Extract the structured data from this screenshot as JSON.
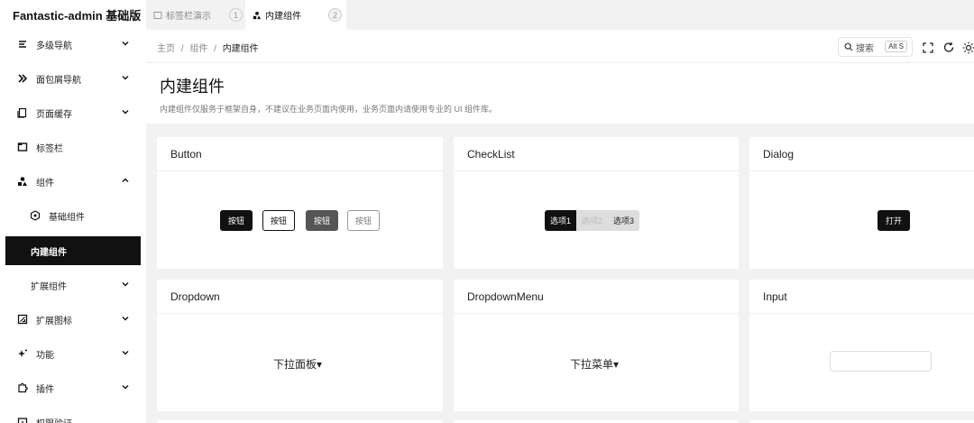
{
  "app": {
    "title": "Fantastic-admin 基础版"
  },
  "sidebar": {
    "items": [
      {
        "label": "多级导航",
        "icon": "menu-lines-icon",
        "chevron": "down"
      },
      {
        "label": "面包屑导航",
        "icon": "double-chevron-icon",
        "chevron": "down"
      },
      {
        "label": "页面缓存",
        "icon": "pages-icon",
        "chevron": "down"
      },
      {
        "label": "标签栏",
        "icon": "tab-window-icon"
      },
      {
        "label": "组件",
        "icon": "shapes-icon",
        "chevron": "up"
      },
      {
        "label": "基础组件",
        "icon": "component-icon"
      },
      {
        "label": "内建组件",
        "active": true
      },
      {
        "label": "扩展组件",
        "chevron": "down"
      },
      {
        "label": "扩展图标",
        "icon": "icon-box-icon",
        "chevron": "down"
      },
      {
        "label": "功能",
        "icon": "sparkle-icon",
        "chevron": "down"
      },
      {
        "label": "插件",
        "icon": "puzzle-icon",
        "chevron": "down"
      },
      {
        "label": "权限验证",
        "icon": "shield-icon"
      }
    ]
  },
  "tabs": [
    {
      "label": "标签栏演示",
      "num": "1"
    },
    {
      "label": "内建组件",
      "num": "2",
      "active": true
    }
  ],
  "breadcrumb": {
    "home": "主页",
    "sep": "/",
    "parent": "组件",
    "current": "内建组件"
  },
  "search": {
    "label": "搜索",
    "shortcut": "Alt S"
  },
  "page": {
    "title": "内建组件",
    "description": "内建组件仅服务于框架自身，不建议在业务页面内使用，业务页面内请使用专业的 UI 组件库。"
  },
  "cards": {
    "button": {
      "title": "Button",
      "buttons": [
        "按钮",
        "按钮",
        "按钮",
        "按钮"
      ]
    },
    "checklist": {
      "title": "CheckList",
      "options": [
        "选项1",
        "选项2",
        "选项3"
      ]
    },
    "dialog": {
      "title": "Dialog",
      "open_label": "打开"
    },
    "dropdown": {
      "title": "Dropdown",
      "trigger": "下拉面板▾"
    },
    "dropdownmenu": {
      "title": "DropdownMenu",
      "trigger": "下拉菜单▾"
    },
    "input": {
      "title": "Input",
      "value": ""
    }
  },
  "colors": {
    "primary": "#111111",
    "background": "#f2f2f2"
  }
}
